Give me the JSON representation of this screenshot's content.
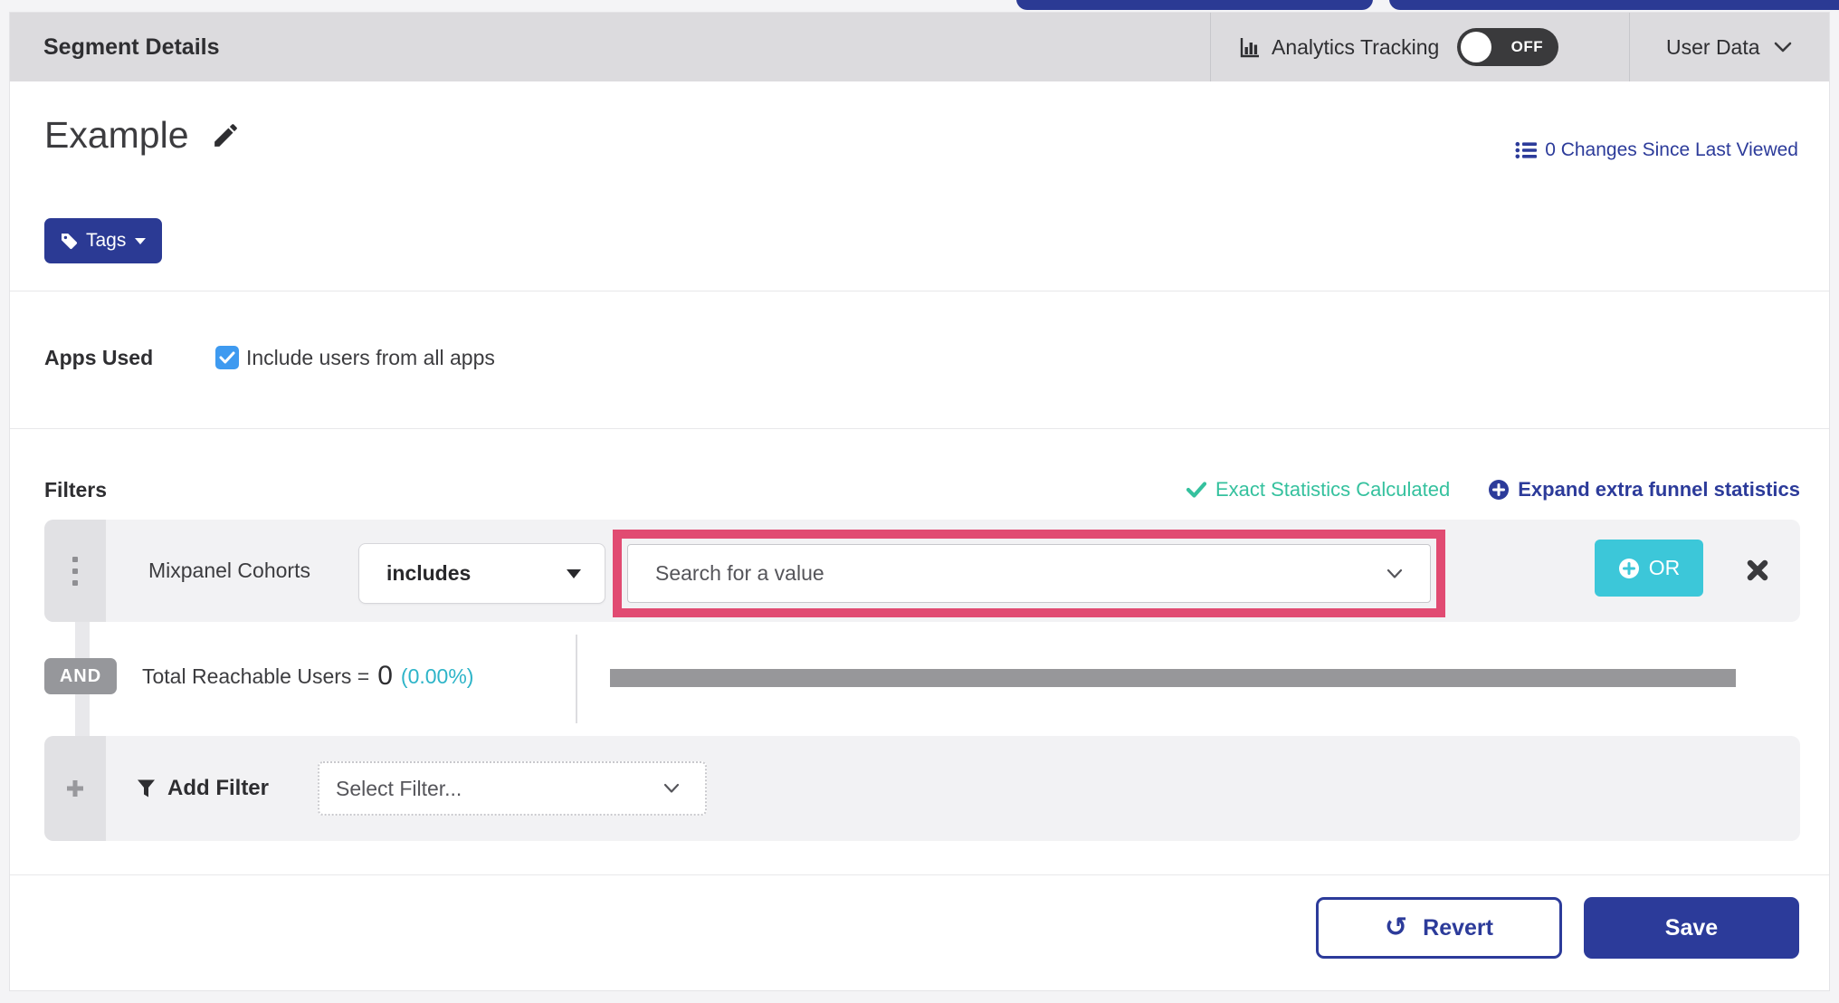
{
  "header": {
    "title": "Segment Details",
    "analytics_label": "Analytics Tracking",
    "toggle_state": "OFF",
    "user_data_label": "User Data"
  },
  "segment": {
    "name": "Example",
    "tags_label": "Tags",
    "changes_link": "0 Changes Since Last Viewed"
  },
  "apps_used": {
    "label": "Apps Used",
    "checkbox_label": "Include users from all apps",
    "checked": true
  },
  "filters": {
    "heading": "Filters",
    "exact_stats": "Exact Statistics Calculated",
    "expand_link": "Expand extra funnel statistics",
    "row": {
      "field": "Mixpanel Cohorts",
      "operator": "includes",
      "value_placeholder": "Search for a value",
      "or_label": "OR"
    },
    "and_label": "AND",
    "reachable": {
      "label": "Total Reachable Users =",
      "value": "0",
      "percent": "(0.00%)"
    },
    "add_filter": {
      "label": "Add Filter",
      "select_placeholder": "Select Filter..."
    }
  },
  "footer": {
    "revert_label": "Revert",
    "save_label": "Save"
  },
  "colors": {
    "brand_blue": "#2b3a94",
    "link_blue": "#2c3b9a",
    "cyan_button": "#3cc7d9",
    "cyan_text": "#2db4c8",
    "green": "#35c19e",
    "pink_highlight": "#e14b72",
    "checkbox_blue": "#3e9af0",
    "gray_bar": "#97979a",
    "topbar_gray": "#dcdbde"
  }
}
